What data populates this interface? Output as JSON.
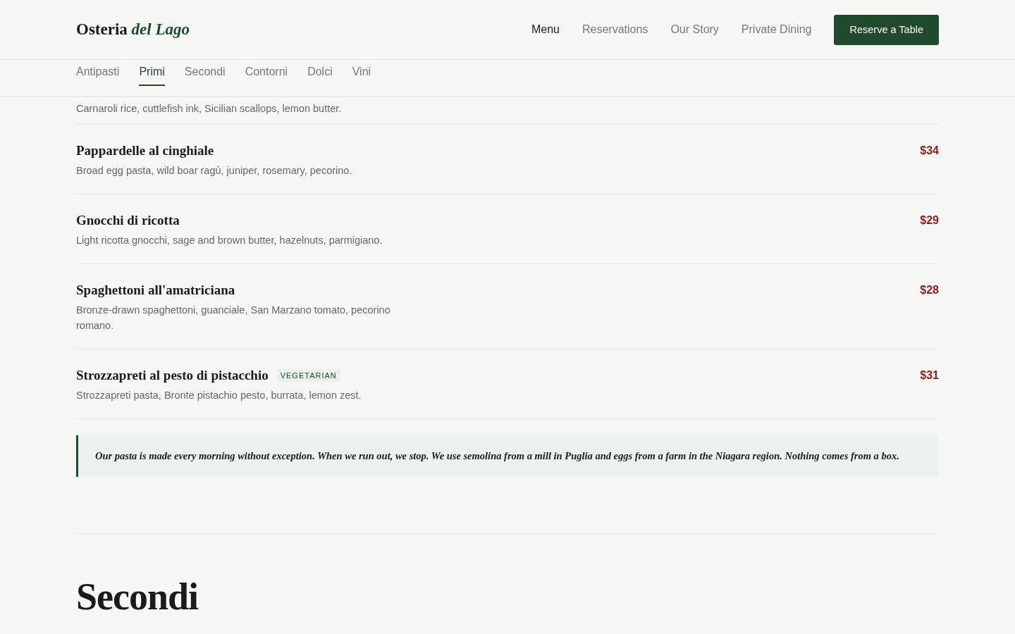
{
  "brand": {
    "name": "Osteria",
    "accent": "del Lago"
  },
  "nav": [
    {
      "label": "Menu",
      "selected": true
    },
    {
      "label": "Reservations",
      "selected": false
    },
    {
      "label": "Our Story",
      "selected": false
    },
    {
      "label": "Private Dining",
      "selected": false
    }
  ],
  "cta": "Reserve a Table",
  "tabs": [
    {
      "label": "Antipasti",
      "selected": false
    },
    {
      "label": "Primi",
      "selected": true
    },
    {
      "label": "Secondi",
      "selected": false
    },
    {
      "label": "Contorni",
      "selected": false
    },
    {
      "label": "Dolci",
      "selected": false
    },
    {
      "label": "Vini",
      "selected": false
    }
  ],
  "partial_description": "Carnaroli rice, cuttlefish ink, Sicilian scallops, lemon butter.",
  "dishes": [
    {
      "name": "Pappardelle al cinghiale",
      "description": "Broad egg pasta, wild boar ragù, juniper, rosemary, pecorino.",
      "price": "$34"
    },
    {
      "name": "Gnocchi di ricotta",
      "description": "Light ricotta gnocchi, sage and brown butter, hazelnuts, parmigiano.",
      "price": "$29"
    },
    {
      "name": "Spaghettoni all'amatriciana",
      "description": "Bronze-drawn spaghettoni, guanciale, San Marzano tomato, pecorino romano.",
      "price": "$28"
    },
    {
      "name": "Strozzapreti al pesto di pistacchio",
      "tag": "VEGETARIAN",
      "description": "Strozzapreti pasta, Bronte pistachio pesto, burrata, lemon zest.",
      "price": "$31"
    }
  ],
  "note": "Our pasta is made every morning without exception. When we run out, we stop. We use semolina from a mill in Puglia and eggs from a farm in the Niagara region. Nothing comes from a box.",
  "next_section": "Secondi"
}
